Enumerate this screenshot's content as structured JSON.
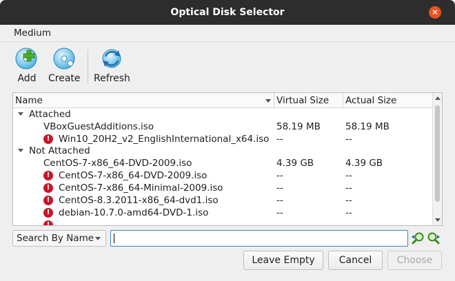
{
  "window": {
    "title": "Optical Disk Selector",
    "close_glyph": "✕"
  },
  "menu": {
    "medium": "Medium"
  },
  "toolbar": {
    "add": {
      "label": "Add",
      "icon": "add-disk-icon"
    },
    "create": {
      "label": "Create",
      "icon": "create-disk-icon"
    },
    "refresh": {
      "label": "Refresh",
      "icon": "refresh-icon"
    }
  },
  "table": {
    "columns": {
      "name": "Name",
      "virtual": "Virtual Size",
      "actual": "Actual Size"
    },
    "groups": {
      "attached": "Attached",
      "not_attached": "Not Attached"
    },
    "rows": [
      {
        "name": "VBoxGuestAdditions.iso",
        "virtual": "58.19 MB",
        "actual": "58.19 MB",
        "error": false
      },
      {
        "name": "Win10_20H2_v2_EnglishInternational_x64.iso",
        "virtual": "--",
        "actual": "--",
        "error": true
      },
      {
        "name": "CentOS-7-x86_64-DVD-2009.iso",
        "virtual": "4.39 GB",
        "actual": "4.39 GB",
        "error": false
      },
      {
        "name": "CentOS-7-x86_64-DVD-2009.iso",
        "virtual": "--",
        "actual": "--",
        "error": true
      },
      {
        "name": "CentOS-7-x86_64-Minimal-2009.iso",
        "virtual": "--",
        "actual": "--",
        "error": true
      },
      {
        "name": "CentOS-8.3.2011-x86_64-dvd1.iso",
        "virtual": "--",
        "actual": "--",
        "error": true
      },
      {
        "name": "debian-10.7.0-amd64-DVD-1.iso",
        "virtual": "--",
        "actual": "--",
        "error": true
      }
    ]
  },
  "search": {
    "mode": "Search By Name",
    "value": "",
    "placeholder": ""
  },
  "footer": {
    "leave_empty": "Leave Empty",
    "cancel": "Cancel",
    "choose": "Choose"
  },
  "colors": {
    "titlebar": "#2d2d2d",
    "close": "#e95420",
    "error": "#c7162b",
    "focus": "#3b7fc4"
  }
}
